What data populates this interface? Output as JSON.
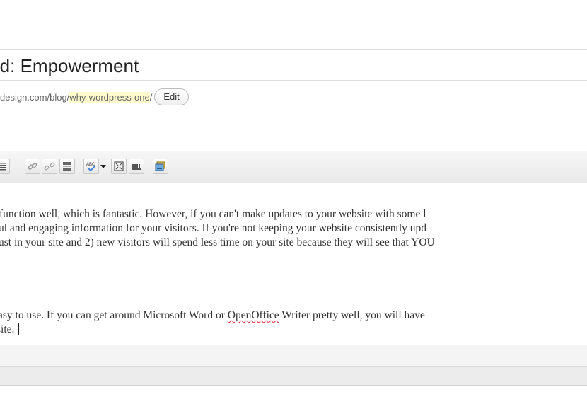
{
  "post": {
    "title": "rd:  Empowerment",
    "permalink_prefix": "design.com/blog/",
    "permalink_slug": "why-wordpress-one",
    "permalink_suffix": "/",
    "edit_label": "Edit"
  },
  "toolbar": {
    "buttons": [
      "align-justify-icon",
      "link-icon",
      "unlink-icon",
      "insert-more-icon",
      "spellcheck-icon",
      "dropdown-arrow-icon",
      "fullscreen-icon",
      "kitchen-sink-icon",
      "add-media-icon"
    ]
  },
  "editor": {
    "p1_line1": "function well, which is fantastic.  However, if you can't make updates to your website with some l",
    "p1_line2": "ul and engaging information for your visitors.  If you're not keeping your website consistently upd",
    "p1_line3": "ust in your site and 2) new visitors will spend less time on your site because they will see that YOU",
    "p2_line1_a": "asy to use.   If you can get around Microsoft Word or ",
    "p2_line1_b": "OpenOffice",
    "p2_line1_c": " Writer pretty well, you will have",
    "p2_line2": "site."
  }
}
